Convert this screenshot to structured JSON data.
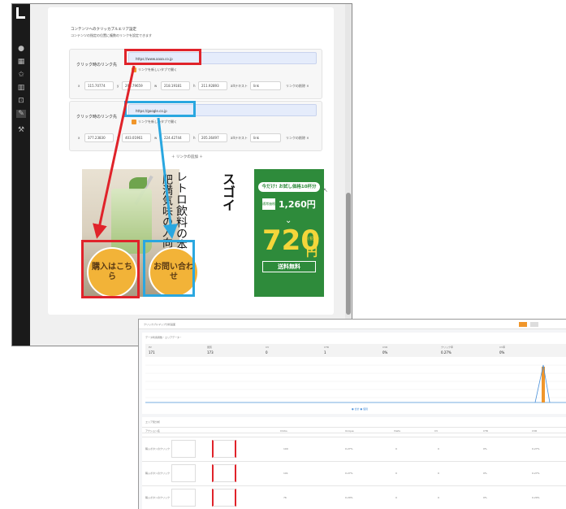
{
  "editor": {
    "section_title": "コンテンツへのクリッカブルエリア設定",
    "section_sub": "コンテンツの指定の位置に複数のリンクを設定できます",
    "areas": [
      {
        "label": "クリック時のリンク先",
        "url": "https://www.aaaa.co.jp",
        "new_tab": "リンクを新しいタブで開く",
        "x": "115.70774",
        "y": "293.79659",
        "w": "218.19181",
        "h": "211.92893",
        "alt_label": "altテキスト",
        "alt_value": "link",
        "delete": "リンクの削除 ×"
      },
      {
        "label": "クリック時のリンク先",
        "url": "https://google.co.jp",
        "new_tab": "リンクを新しいタブで開く",
        "x": "377.23830",
        "y": "403.01961",
        "w": "224.42744",
        "h": "205.36497",
        "alt_label": "altテキスト",
        "alt_value": "link",
        "delete": "リンクの削除 ×"
      }
    ],
    "add_link": "＋ リンクの追加 ＋",
    "banner": {
      "headline": "スゴイ",
      "line1": "レトロ飲料の本気！",
      "line2": "肥満気味の人向け青汁が",
      "trial": "今だけ! お試し価格10杯分",
      "regular_tag": "通常価格",
      "regular_price": "1,260円",
      "price": "720",
      "price_unit": "円",
      "tax": "(税込)",
      "shipping": "送料無料",
      "buy": "購入はこちら",
      "contact": "お問い合わせ"
    }
  },
  "analytics": {
    "title": "クリッカブルマップ分析画面",
    "summary_label": "データ利用者数・エリアデータ・",
    "stats": [
      {
        "label": "PV",
        "value": "171"
      },
      {
        "label": "閲覧",
        "value": "173"
      },
      {
        "label": "CV",
        "value": "0"
      },
      {
        "label": "CTR",
        "value": "1"
      },
      {
        "label": "CVR",
        "value": "0%"
      },
      {
        "label": "クリック率",
        "value": "0.27%"
      },
      {
        "label": "CV率",
        "value": "0%"
      }
    ],
    "legend": "● 合計 ● 個別",
    "table_title": "エリア別分析",
    "columns": [
      "アクション名",
      "",
      "",
      "",
      "",
      "Clicks",
      "Unique",
      "Visits",
      "CV",
      "CTR",
      "CVR"
    ],
    "rows": [
      {
        "name": "購入ボタンのクリック",
        "v1": "100",
        "v2": "0.27%",
        "v3": "0",
        "v4": "0",
        "v5": "0%",
        "v6": "0.27%"
      },
      {
        "name": "購入ボタンのクリック",
        "v1": "101",
        "v2": "0.27%",
        "v3": "0",
        "v4": "0",
        "v5": "0%",
        "v6": "0.27%"
      },
      {
        "name": "購入ボタンのクリック",
        "v1": "76",
        "v2": "0.20%",
        "v3": "0",
        "v4": "0",
        "v5": "0%",
        "v6": "0.20%"
      }
    ]
  }
}
